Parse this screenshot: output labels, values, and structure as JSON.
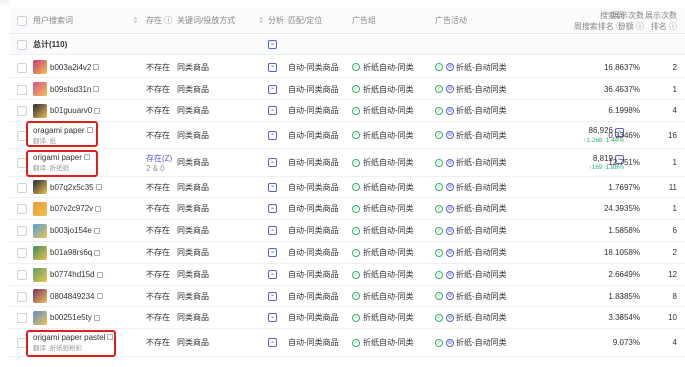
{
  "header": {
    "keyword": "用户搜索词",
    "exists": "存在",
    "exists_info": "ⓘ",
    "type": "关键词/投放方式",
    "analysis": "分析",
    "match": "匹配/定位",
    "ad_group": "广告组",
    "campaign": "广告活动",
    "search_rank_line1": "搜索词",
    "search_rank_line2": "周搜索排名",
    "search_rank_info": "ⓘ",
    "impr_share_line1": "展示次数",
    "impr_share_line2": "份额",
    "impr_share_info": "ⓘ",
    "impr_rank_line1": "展示次数",
    "impr_rank_line2": "排名",
    "impr_rank_info": "ⓘ"
  },
  "total": {
    "label": "总计(110)"
  },
  "rows": [
    {
      "keyword": "b003a2i4v2",
      "exists": "不存在",
      "type": "同类商品",
      "match": "自动-同类商品",
      "group": "折纸自动-同类",
      "campaign": "折纸-自动同类",
      "rank": "--",
      "share": "16.8637%",
      "irank": "2",
      "thumb": "#c8377a"
    },
    {
      "keyword": "b09sfsd31n",
      "exists": "不存在",
      "type": "同类商品",
      "match": "自动-同类商品",
      "group": "折纸自动-同类",
      "campaign": "折纸-自动同类",
      "rank": "--",
      "share": "36.4537%",
      "irank": "1",
      "thumb": "#d34f8f"
    },
    {
      "keyword": "b01guuarv0",
      "exists": "不存在",
      "type": "同类商品",
      "match": "自动-同类商品",
      "group": "折纸自动-同类",
      "campaign": "折纸-自动同类",
      "rank": "--",
      "share": "6.1998%",
      "irank": "4",
      "thumb": "#262636"
    },
    {
      "keyword": "oragami paper",
      "translation": "翻译: 纸",
      "exists": "不存在",
      "type": "同类商品",
      "match": "自动-同类商品",
      "group": "折纸自动-同类",
      "campaign": "折纸-自动同类",
      "rank": "86,926",
      "rank_change": "↑1,268",
      "rank_pct": "1.44%",
      "share": "0.3346%",
      "irank": "16"
    },
    {
      "keyword": "origami paper",
      "translation": "翻译: 折纸纸",
      "exists": "存在(Z)",
      "exists_sub": "2 & 0",
      "type": "同类商品",
      "match": "自动-同类商品",
      "group": "折纸自动-同类",
      "campaign": "折纸-自动同类",
      "rank": "8,819",
      "rank_change": "↑169",
      "rank_pct": "1.88%",
      "share": "12.751%",
      "irank": "1"
    },
    {
      "keyword": "b07q2x5c35",
      "exists": "不存在",
      "type": "同类商品",
      "match": "自动-同类商品",
      "group": "折纸自动-同类",
      "campaign": "折纸-自动同类",
      "rank": "--",
      "share": "1.7697%",
      "irank": "11",
      "thumb": "#1f2a3a"
    },
    {
      "keyword": "b07v2c972v",
      "exists": "不存在",
      "type": "同类商品",
      "match": "自动-同类商品",
      "group": "折纸自动-同类",
      "campaign": "折纸-自动同类",
      "rank": "--",
      "share": "24.3935%",
      "irank": "1",
      "thumb": "#e89b3a"
    },
    {
      "keyword": "b003jo154e",
      "exists": "不存在",
      "type": "同类商品",
      "match": "自动-同类商品",
      "group": "折纸自动-同类",
      "campaign": "折纸-自动同类",
      "rank": "--",
      "share": "1.5858%",
      "irank": "6",
      "thumb": "#4aa3df"
    },
    {
      "keyword": "b01a98rs6q",
      "exists": "不存在",
      "type": "同类商品",
      "match": "自动-同类商品",
      "group": "折纸自动-同类",
      "campaign": "折纸-自动同类",
      "rank": "--",
      "share": "18.1058%",
      "irank": "2",
      "thumb": "#3a8f5c"
    },
    {
      "keyword": "b0774hd15d",
      "exists": "不存在",
      "type": "同类商品",
      "match": "自动-同类商品",
      "group": "折纸自动-同类",
      "campaign": "折纸-自动同类",
      "rank": "--",
      "share": "2.6649%",
      "irank": "12",
      "thumb": "#57a36a"
    },
    {
      "keyword": "0804849234",
      "exists": "不存在",
      "type": "同类商品",
      "match": "自动-同类商品",
      "group": "折纸自动-同类",
      "campaign": "折纸-自动同类",
      "rank": "--",
      "share": "1.8385%",
      "irank": "8",
      "thumb": "#7a2d6b"
    },
    {
      "keyword": "b00251e5ty",
      "exists": "不存在",
      "type": "同类商品",
      "match": "自动-同类商品",
      "group": "折纸自动-同类",
      "campaign": "折纸-自动同类",
      "rank": "--",
      "share": "3.3854%",
      "irank": "10",
      "thumb": "#5b8fcf"
    },
    {
      "keyword": "origami paper pastel",
      "translation": "翻译: 折纸纸粉彩",
      "exists": "不存在",
      "type": "同类商品",
      "match": "自动-同类商品",
      "group": "折纸自动-同类",
      "campaign": "折纸-自动同类",
      "rank": "--",
      "share": "9.073%",
      "irank": "4"
    }
  ]
}
